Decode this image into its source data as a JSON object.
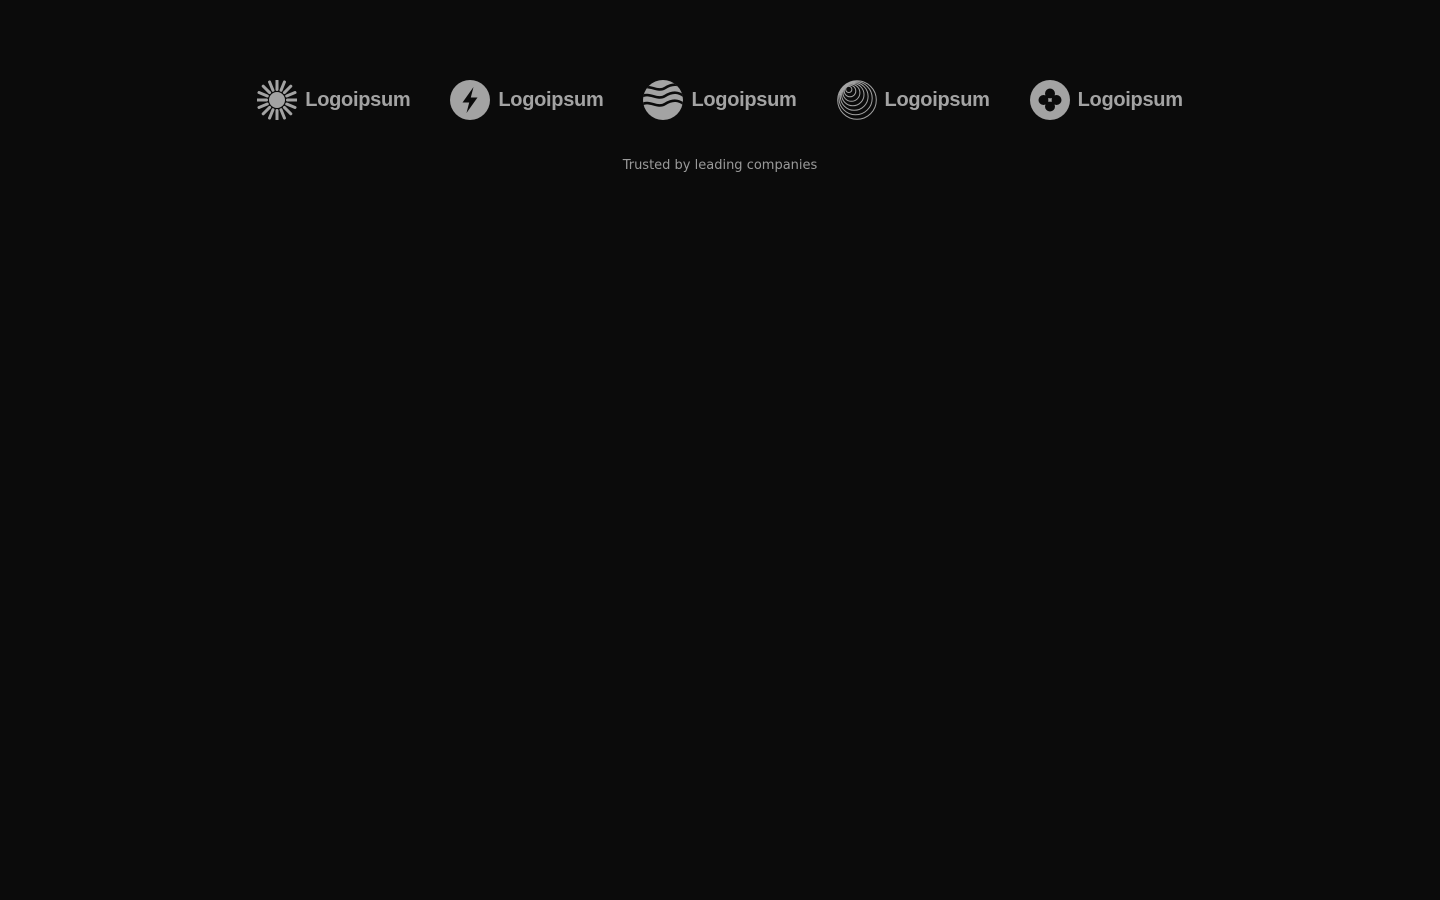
{
  "colors": {
    "background": "#0b0b0b",
    "logo": "#a3a3a3",
    "tagline": "#9a9a9a"
  },
  "logos": [
    {
      "icon": "sunburst-icon",
      "name": "Logoipsum"
    },
    {
      "icon": "lightning-bolt-icon",
      "name": "Logoipsum"
    },
    {
      "icon": "waves-icon",
      "name": "Logoipsum"
    },
    {
      "icon": "concentric-rings-icon",
      "name": "Logoipsum"
    },
    {
      "icon": "clover-icon",
      "name": "Logoipsum"
    }
  ],
  "tagline": "Trusted by leading companies"
}
